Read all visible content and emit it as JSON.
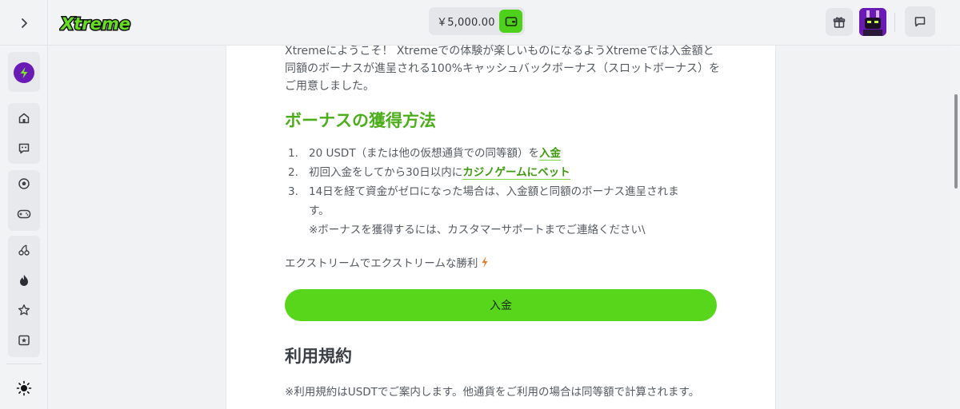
{
  "header": {
    "logo_text": "Xtreme",
    "balance": "￥5,000.00"
  },
  "icons": {
    "collapse": "chevron-right-icon",
    "wallet": "wallet-icon",
    "gift": "gift-icon",
    "chat": "chat-icon",
    "bolt": "lightning-icon",
    "home": "home-icon",
    "support": "support-chat-icon",
    "sports": "soccer-ball-icon",
    "games": "gamepad-icon",
    "slots": "cherries-icon",
    "hot": "fire-icon",
    "favorites": "star-icon",
    "live": "live-casino-icon",
    "theme": "sun-icon"
  },
  "colors": {
    "accent": "#57d61c",
    "heading": "#4cae1a",
    "avatar": "#6a1bb5"
  },
  "content": {
    "intro": "Xtremeにようこそ！ Xtremeでの体験が楽しいものになるようXtremeでは入金額と同額のボーナスが進呈される100%キャッシュバックボーナス（スロットボーナス）をご用意しました。",
    "how_title": "ボーナスの獲得方法",
    "steps": [
      {
        "num": "1.",
        "text": "20 USDT（または他の仮想通貨での同等額）を",
        "link": "入金"
      },
      {
        "num": "2.",
        "text": "初回入金をしてから30日以内に",
        "link": "カジノゲームにベット"
      },
      {
        "num": "3.",
        "text": "14日を経て資金がゼロになった場合は、入金額と同額のボーナス進呈されます。"
      }
    ],
    "step_note": "※ボーナスを獲得するには、カスタマーサポートまでご連絡ください\\",
    "tagline": "エクストリームでエクストリームな勝利",
    "deposit_button": "入金",
    "terms_title": "利用規約",
    "terms_note": "※利用規約はUSDTでご案内します。他通貨をご利用の場合は同等額で計算されます。"
  }
}
